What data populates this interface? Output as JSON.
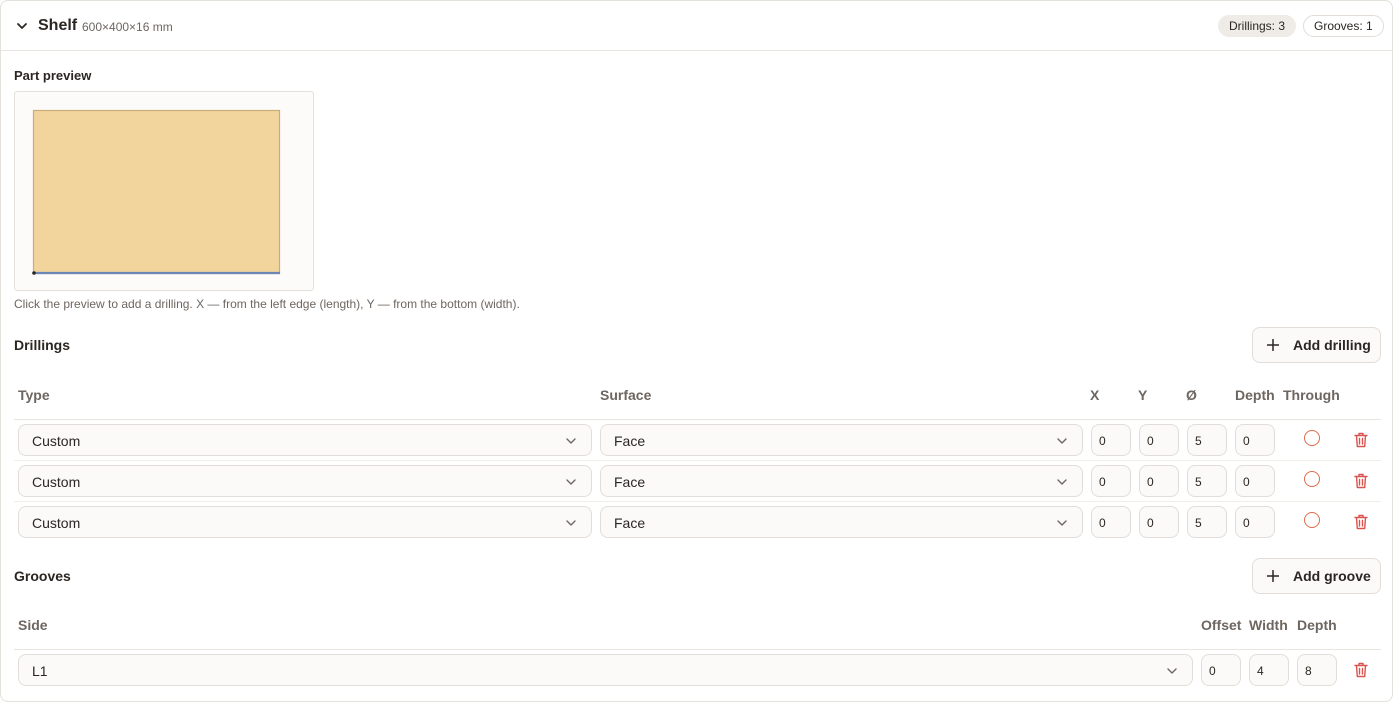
{
  "part": {
    "title": "Shelf",
    "dims": "600×400×16 mm"
  },
  "badges": {
    "drillings": "Drillings: 3",
    "grooves": "Grooves: 1"
  },
  "preview": {
    "label": "Part preview",
    "hint": "Click the preview to add a drilling. X — from the left edge (length), Y — from the bottom (width).",
    "board_color": "#f2d59d",
    "edge_color": "#6b86b5"
  },
  "drillings": {
    "title": "Drillings",
    "add_label": "Add drilling",
    "headers": {
      "type": "Type",
      "surface": "Surface",
      "x": "X",
      "y": "Y",
      "dia": "Ø",
      "depth": "Depth",
      "through": "Through"
    },
    "rows": [
      {
        "type": "Custom",
        "surface": "Face",
        "x": "0",
        "y": "0",
        "dia": "5",
        "depth": "0"
      },
      {
        "type": "Custom",
        "surface": "Face",
        "x": "0",
        "y": "0",
        "dia": "5",
        "depth": "0"
      },
      {
        "type": "Custom",
        "surface": "Face",
        "x": "0",
        "y": "0",
        "dia": "5",
        "depth": "0"
      }
    ]
  },
  "grooves": {
    "title": "Grooves",
    "add_label": "Add groove",
    "headers": {
      "side": "Side",
      "offset": "Offset",
      "width": "Width",
      "depth": "Depth"
    },
    "rows": [
      {
        "side": "L1",
        "offset": "0",
        "width": "4",
        "depth": "8"
      }
    ]
  },
  "colors": {
    "accent": "#e06b4a",
    "danger": "#d9534f"
  }
}
